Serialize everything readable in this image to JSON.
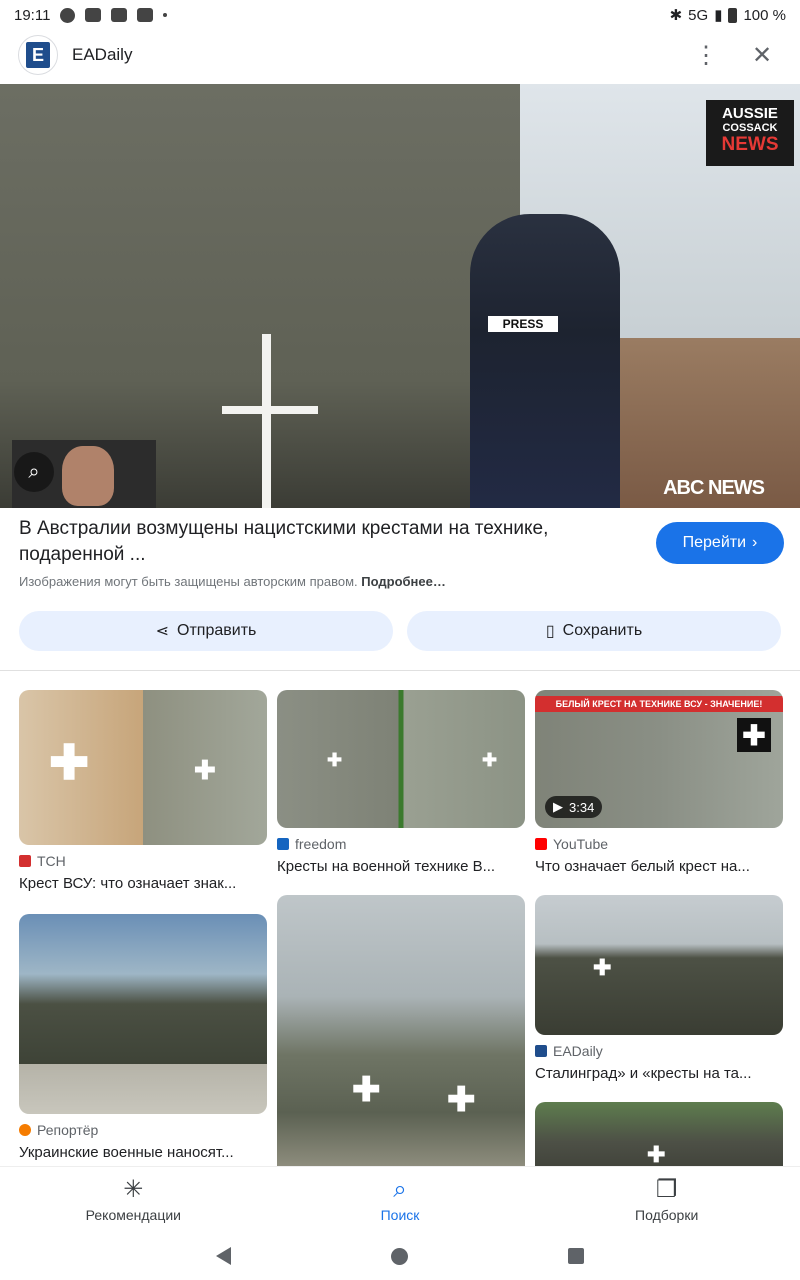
{
  "status_bar": {
    "time": "19:11",
    "network": "5G",
    "battery": "100 %"
  },
  "app_bar": {
    "site_name": "EADaily",
    "logo_letter": "E"
  },
  "hero": {
    "badge_line1": "AUSSIE",
    "badge_line2": "COSSACK",
    "badge_line3": "NEWS",
    "watermark": "ABC NEWS",
    "vest_text": "PRESS"
  },
  "result": {
    "title": "В Австралии возмущены нацистскими крестами на технике, подаренной ...",
    "copyright": "Изображения могут быть защищены авторским правом.",
    "copyright_more": "Подробнее…",
    "go_button": "Перейти"
  },
  "actions": {
    "share": "Отправить",
    "save": "Сохранить"
  },
  "related": [
    {
      "source": "TCH",
      "caption": "Крест ВСУ: что означает знак...",
      "fav_color": "#d32f2f"
    },
    {
      "source": "freedom",
      "caption": "Кресты на военной технике В...",
      "fav_color": "#1565c0"
    },
    {
      "source": "YouTube",
      "caption": "Что означает белый крест на...",
      "fav_color": "#ff0000",
      "duration": "3:34",
      "banner": "БЕЛЫЙ КРЕСТ НА ТЕХНИКЕ ВСУ - ЗНАЧЕНИЕ!"
    },
    {
      "source": "Репортёр",
      "caption": "Украинские военные наносят...",
      "fav_color": "#f57c00"
    },
    {
      "source": "",
      "caption": ""
    },
    {
      "source": "EADaily",
      "caption": "Сталинград» и «кресты на та...",
      "fav_color": "#1f4d8c"
    }
  ],
  "bottom_nav": {
    "recommendations": "Рекомендации",
    "search": "Поиск",
    "collections": "Подборки"
  }
}
